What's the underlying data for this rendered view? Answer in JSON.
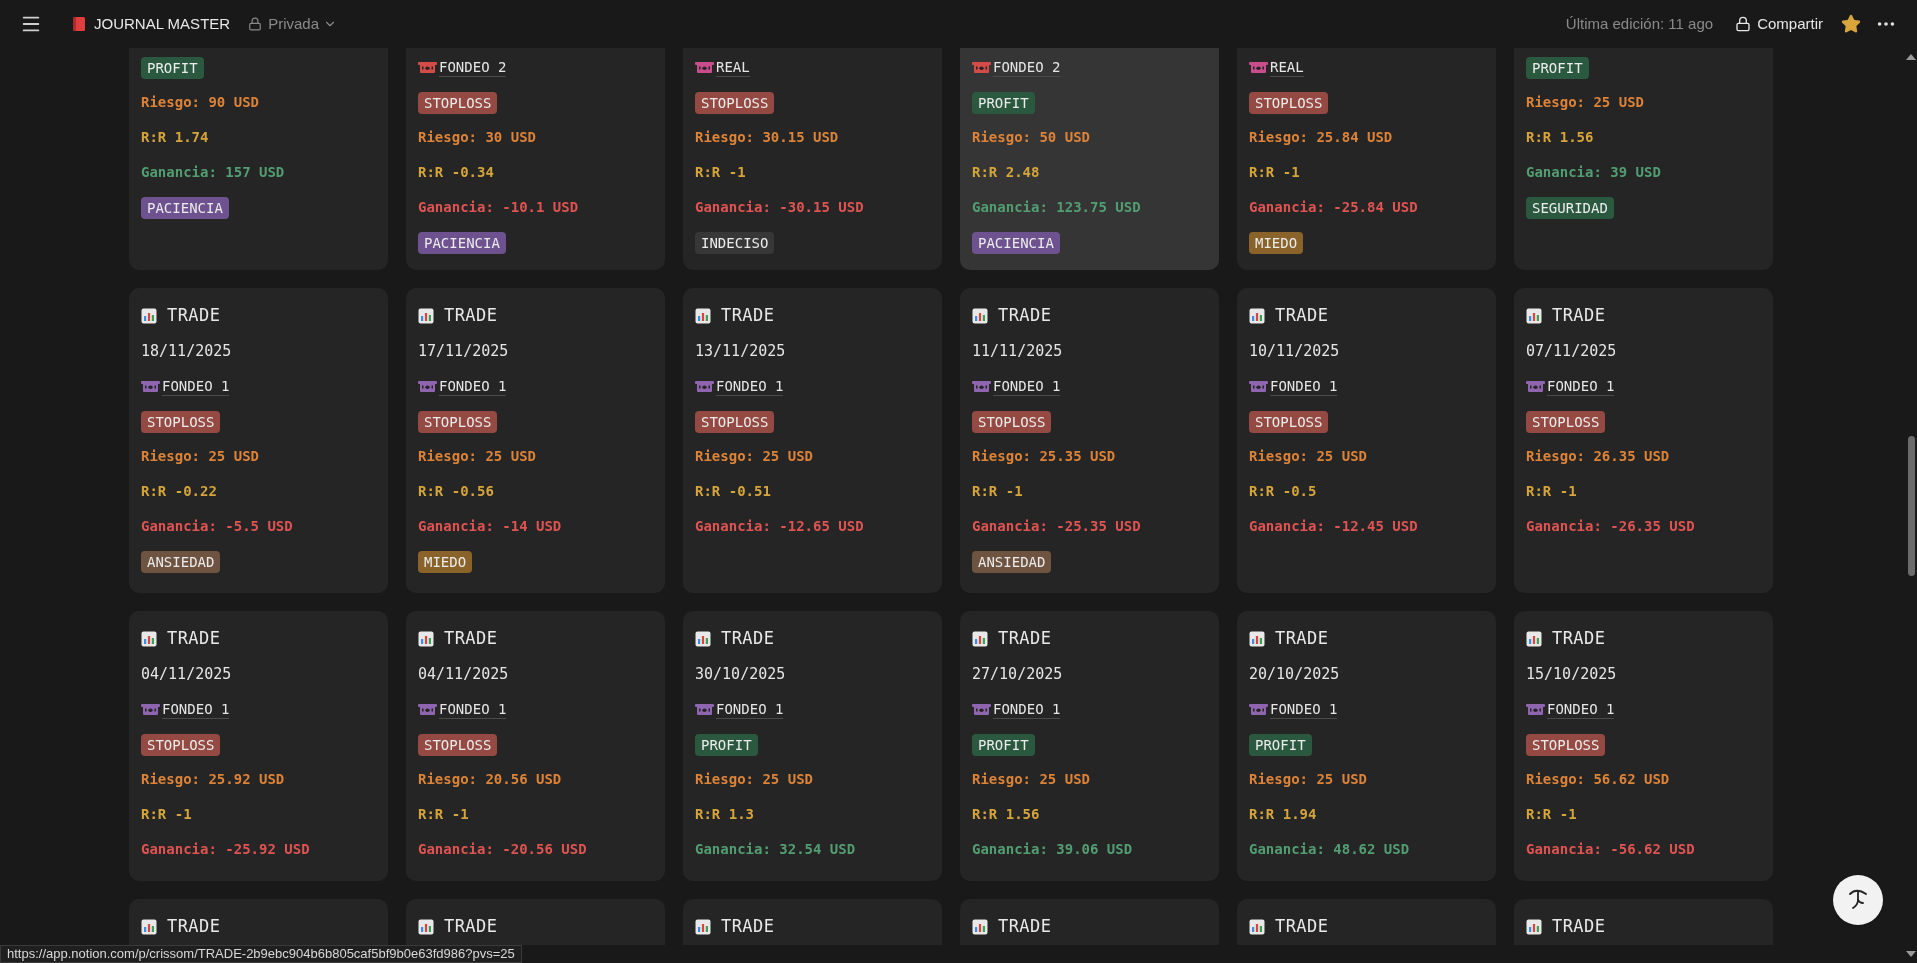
{
  "topbar": {
    "title": "JOURNAL MASTER",
    "privacy": "Privada",
    "last_edit": "Última edición: 11 ago",
    "share": "Compartir",
    "favorite": true
  },
  "rows": [
    {
      "cards": [
        {
          "result": {
            "label": "PROFIT",
            "color": "#2b593f"
          },
          "riesgo": "Riesgo: 90 USD",
          "rr": "R:R 1.74",
          "ganancia": {
            "text": "Ganancia: 157 USD",
            "color": "#529e72"
          },
          "emotion": {
            "label": "PACIENCIA",
            "color": "#6d528f"
          }
        },
        {
          "account": {
            "name": "FONDEO 2",
            "color": "#d44c47"
          },
          "result": {
            "label": "STOPLOSS",
            "color": "#944a43"
          },
          "riesgo": "Riesgo: 30 USD",
          "rr": "R:R -0.34",
          "ganancia": {
            "text": "Ganancia: -10.1 USD",
            "color": "#df5452"
          },
          "emotion": {
            "label": "PACIENCIA",
            "color": "#6d528f"
          }
        },
        {
          "account": {
            "name": "REAL",
            "color": "#c74e8b"
          },
          "result": {
            "label": "STOPLOSS",
            "color": "#944a43"
          },
          "riesgo": "Riesgo: 30.15 USD",
          "rr": "R:R -1",
          "ganancia": {
            "text": "Ganancia: -30.15 USD",
            "color": "#df5452"
          },
          "emotion": {
            "label": "INDECISO",
            "color": "#373737"
          }
        },
        {
          "account": {
            "name": "FONDEO 2",
            "color": "#d44c47"
          },
          "result": {
            "label": "PROFIT",
            "color": "#2b593f"
          },
          "riesgo": "Riesgo: 50 USD",
          "rr": "R:R 2.48",
          "ganancia": {
            "text": "Ganancia: 123.75 USD",
            "color": "#529e72"
          },
          "emotion": {
            "label": "PACIENCIA",
            "color": "#6d528f"
          },
          "hovered": true
        },
        {
          "account": {
            "name": "REAL",
            "color": "#c74e8b"
          },
          "result": {
            "label": "STOPLOSS",
            "color": "#944a43"
          },
          "riesgo": "Riesgo: 25.84 USD",
          "rr": "R:R -1",
          "ganancia": {
            "text": "Ganancia: -25.84 USD",
            "color": "#df5452"
          },
          "emotion": {
            "label": "MIEDO",
            "color": "#89632a"
          }
        },
        {
          "result": {
            "label": "PROFIT",
            "color": "#2b593f"
          },
          "riesgo": "Riesgo: 25 USD",
          "rr": "R:R 1.56",
          "ganancia": {
            "text": "Ganancia: 39 USD",
            "color": "#529e72"
          },
          "emotion": {
            "label": "SEGURIDAD",
            "color": "#2b593f"
          }
        }
      ]
    },
    {
      "cards": [
        {
          "title": "TRADE",
          "date": "18/11/2025",
          "account": {
            "name": "FONDEO 1",
            "color": "#9065b0"
          },
          "result": {
            "label": "STOPLOSS",
            "color": "#944a43"
          },
          "riesgo": "Riesgo: 25 USD",
          "rr": "R:R -0.22",
          "ganancia": {
            "text": "Ganancia: -5.5 USD",
            "color": "#df5452"
          },
          "emotion": {
            "label": "ANSIEDAD",
            "color": "#6e5340"
          }
        },
        {
          "title": "TRADE",
          "date": "17/11/2025",
          "account": {
            "name": "FONDEO 1",
            "color": "#9065b0"
          },
          "result": {
            "label": "STOPLOSS",
            "color": "#944a43"
          },
          "riesgo": "Riesgo: 25 USD",
          "rr": "R:R -0.56",
          "ganancia": {
            "text": "Ganancia: -14 USD",
            "color": "#df5452"
          },
          "emotion": {
            "label": "MIEDO",
            "color": "#89632a"
          }
        },
        {
          "title": "TRADE",
          "date": "13/11/2025",
          "account": {
            "name": "FONDEO 1",
            "color": "#9065b0"
          },
          "result": {
            "label": "STOPLOSS",
            "color": "#944a43"
          },
          "riesgo": "Riesgo: 25 USD",
          "rr": "R:R -0.51",
          "ganancia": {
            "text": "Ganancia: -12.65 USD",
            "color": "#df5452"
          }
        },
        {
          "title": "TRADE",
          "date": "11/11/2025",
          "account": {
            "name": "FONDEO 1",
            "color": "#9065b0"
          },
          "result": {
            "label": "STOPLOSS",
            "color": "#944a43"
          },
          "riesgo": "Riesgo: 25.35 USD",
          "rr": "R:R -1",
          "ganancia": {
            "text": "Ganancia: -25.35 USD",
            "color": "#df5452"
          },
          "emotion": {
            "label": "ANSIEDAD",
            "color": "#6e5340"
          }
        },
        {
          "title": "TRADE",
          "date": "10/11/2025",
          "account": {
            "name": "FONDEO 1",
            "color": "#9065b0"
          },
          "result": {
            "label": "STOPLOSS",
            "color": "#944a43"
          },
          "riesgo": "Riesgo: 25 USD",
          "rr": "R:R -0.5",
          "ganancia": {
            "text": "Ganancia: -12.45 USD",
            "color": "#df5452"
          }
        },
        {
          "title": "TRADE",
          "date": "07/11/2025",
          "account": {
            "name": "FONDEO 1",
            "color": "#9065b0"
          },
          "result": {
            "label": "STOPLOSS",
            "color": "#944a43"
          },
          "riesgo": "Riesgo: 26.35 USD",
          "rr": "R:R -1",
          "ganancia": {
            "text": "Ganancia: -26.35 USD",
            "color": "#df5452"
          }
        }
      ]
    },
    {
      "cards": [
        {
          "title": "TRADE",
          "date": "04/11/2025",
          "account": {
            "name": "FONDEO 1",
            "color": "#9065b0"
          },
          "result": {
            "label": "STOPLOSS",
            "color": "#944a43"
          },
          "riesgo": "Riesgo: 25.92 USD",
          "rr": "R:R -1",
          "ganancia": {
            "text": "Ganancia: -25.92 USD",
            "color": "#df5452"
          }
        },
        {
          "title": "TRADE",
          "date": "04/11/2025",
          "account": {
            "name": "FONDEO 1",
            "color": "#9065b0"
          },
          "result": {
            "label": "STOPLOSS",
            "color": "#944a43"
          },
          "riesgo": "Riesgo: 20.56 USD",
          "rr": "R:R -1",
          "ganancia": {
            "text": "Ganancia: -20.56 USD",
            "color": "#df5452"
          }
        },
        {
          "title": "TRADE",
          "date": "30/10/2025",
          "account": {
            "name": "FONDEO 1",
            "color": "#9065b0"
          },
          "result": {
            "label": "PROFIT",
            "color": "#2b593f"
          },
          "riesgo": "Riesgo: 25 USD",
          "rr": "R:R 1.3",
          "ganancia": {
            "text": "Ganancia: 32.54 USD",
            "color": "#529e72"
          }
        },
        {
          "title": "TRADE",
          "date": "27/10/2025",
          "account": {
            "name": "FONDEO 1",
            "color": "#9065b0"
          },
          "result": {
            "label": "PROFIT",
            "color": "#2b593f"
          },
          "riesgo": "Riesgo: 25 USD",
          "rr": "R:R 1.56",
          "ganancia": {
            "text": "Ganancia: 39.06 USD",
            "color": "#529e72"
          }
        },
        {
          "title": "TRADE",
          "date": "20/10/2025",
          "account": {
            "name": "FONDEO 1",
            "color": "#9065b0"
          },
          "result": {
            "label": "PROFIT",
            "color": "#2b593f"
          },
          "riesgo": "Riesgo: 25 USD",
          "rr": "R:R 1.94",
          "ganancia": {
            "text": "Ganancia: 48.62 USD",
            "color": "#529e72"
          }
        },
        {
          "title": "TRADE",
          "date": "15/10/2025",
          "account": {
            "name": "FONDEO 1",
            "color": "#9065b0"
          },
          "result": {
            "label": "STOPLOSS",
            "color": "#944a43"
          },
          "riesgo": "Riesgo: 56.62 USD",
          "rr": "R:R -1",
          "ganancia": {
            "text": "Ganancia: -56.62 USD",
            "color": "#df5452"
          }
        }
      ]
    },
    {
      "cards": [
        {
          "title": "TRADE"
        },
        {
          "title": "TRADE"
        },
        {
          "title": "TRADE"
        },
        {
          "title": "TRADE"
        },
        {
          "title": "TRADE"
        },
        {
          "title": "TRADE"
        }
      ]
    }
  ],
  "status_url": "https://app.notion.com/p/crissom/TRADE-2b9ebc904b6b805caf5bf9b0e63fd986?pvs=25"
}
